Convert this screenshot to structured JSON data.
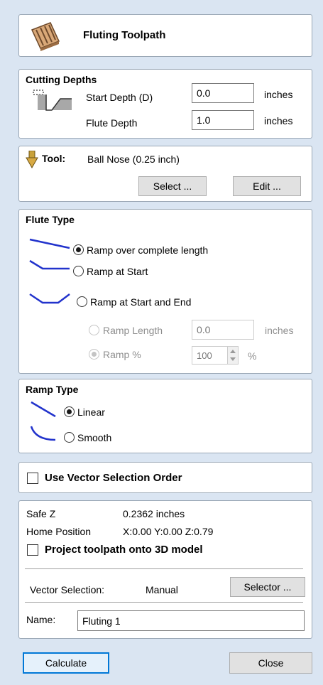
{
  "header": {
    "title": "Fluting Toolpath",
    "icon": "fluting-icon"
  },
  "cutting_depths": {
    "title": "Cutting Depths",
    "start_depth_label": "Start Depth (D)",
    "start_depth_value": "0.0",
    "flute_depth_label": "Flute Depth",
    "flute_depth_value": "1.0",
    "units": "inches"
  },
  "tool": {
    "label": "Tool:",
    "name": "Ball Nose (0.25 inch)",
    "select_label": "Select ...",
    "edit_label": "Edit ..."
  },
  "flute_type": {
    "title": "Flute Type",
    "options": [
      {
        "label": "Ramp over complete length",
        "checked": true
      },
      {
        "label": "Ramp at Start",
        "checked": false
      },
      {
        "label": "Ramp at Start and End",
        "checked": false
      }
    ],
    "ramp_length_label": "Ramp Length",
    "ramp_length_value": "0.0",
    "ramp_length_units": "inches",
    "ramp_percent_label": "Ramp %",
    "ramp_percent_value": "100",
    "ramp_percent_units": "%"
  },
  "ramp_type": {
    "title": "Ramp Type",
    "options": [
      {
        "label": "Linear",
        "checked": true
      },
      {
        "label": "Smooth",
        "checked": false
      }
    ]
  },
  "vector_order": {
    "label": "Use Vector Selection Order",
    "checked": false
  },
  "info": {
    "safe_z_label": "Safe Z",
    "safe_z_value": "0.2362 inches",
    "home_label": "Home Position",
    "home_value": "X:0.00 Y:0.00 Z:0.79",
    "project_label": "Project toolpath onto 3D model",
    "vector_selection_label": "Vector Selection:",
    "vector_selection_value": "Manual",
    "selector_label": "Selector ...",
    "name_label": "Name:",
    "name_value": "Fluting 1"
  },
  "footer": {
    "calculate_label": "Calculate",
    "close_label": "Close"
  },
  "colors": {
    "accent": "#0078d7",
    "curve": "#2233cc",
    "background": "#dae5f2"
  }
}
